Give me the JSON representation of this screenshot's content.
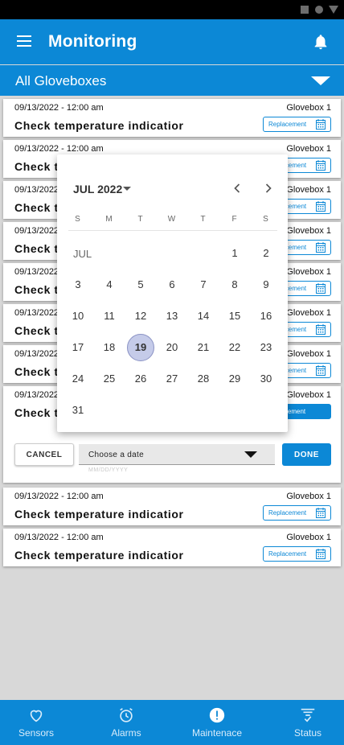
{
  "app": {
    "title": "Monitoring"
  },
  "filter": {
    "label": "All Gloveboxes"
  },
  "cards": [
    {
      "date": "09/13/2022 - 12:00 am",
      "glovebox": "Glovebox 1",
      "task": "Check temperature indicatior",
      "tag": "Replacement"
    },
    {
      "date": "09/13/2022 - 12:00 am",
      "glovebox": "Glovebox 1",
      "task": "Check t",
      "tag": "Replacement"
    },
    {
      "date": "09/13/2022 - 12:00 am",
      "glovebox": "Glovebox 1",
      "task": "Check t",
      "tag": "Replacement"
    },
    {
      "date": "09/13/2022 - 12:00 am",
      "glovebox": "Glovebox 1",
      "task": "Check t",
      "tag": "Replacement"
    },
    {
      "date": "09/13/2022 - 12:00 am",
      "glovebox": "Glovebox 1",
      "task": "Check t",
      "tag": "Replacement"
    },
    {
      "date": "09/13/2022 - 12:00 am",
      "glovebox": "Glovebox 1",
      "task": "Check t",
      "tag": "Replacement"
    },
    {
      "date": "09/13/2022 - 12:00 am",
      "glovebox": "Glovebox 1",
      "task": "Check t",
      "tag": "Replacement"
    }
  ],
  "expanded": {
    "date": "09/13/2022 - 12:00 am",
    "glovebox": "Glovebox 1",
    "task": "Check t",
    "tag": "Replacement",
    "cancel_label": "CANCEL",
    "date_select_label": "Choose a date",
    "date_hint": "MM/DD/YYYY",
    "done_label": "DONE"
  },
  "cards_after": [
    {
      "date": "09/13/2022 - 12:00 am",
      "glovebox": "Glovebox 1",
      "task": "Check temperature indicatior",
      "tag": "Replacement"
    },
    {
      "date": "09/13/2022 - 12:00 am",
      "glovebox": "Glovebox 1",
      "task": "Check temperature indicatior",
      "tag": "Replacement"
    }
  ],
  "date_picker": {
    "month_label": "JUL 2022",
    "month_short": "JUL",
    "weekdays": [
      "S",
      "M",
      "T",
      "W",
      "T",
      "F",
      "S"
    ],
    "first_weekday_index": 5,
    "days_in_month": 31,
    "selected_day": 19,
    "selected_color": "#c5cbe9"
  },
  "bottom_nav": [
    {
      "label": "Sensors",
      "icon": "heart-icon"
    },
    {
      "label": "Alarms",
      "icon": "alarm-clock-icon"
    },
    {
      "label": "Maintenace",
      "icon": "alert-circle-icon"
    },
    {
      "label": "Status",
      "icon": "filter-check-icon"
    }
  ],
  "colors": {
    "primary": "#0c88d6",
    "background": "#d8d8d8"
  }
}
